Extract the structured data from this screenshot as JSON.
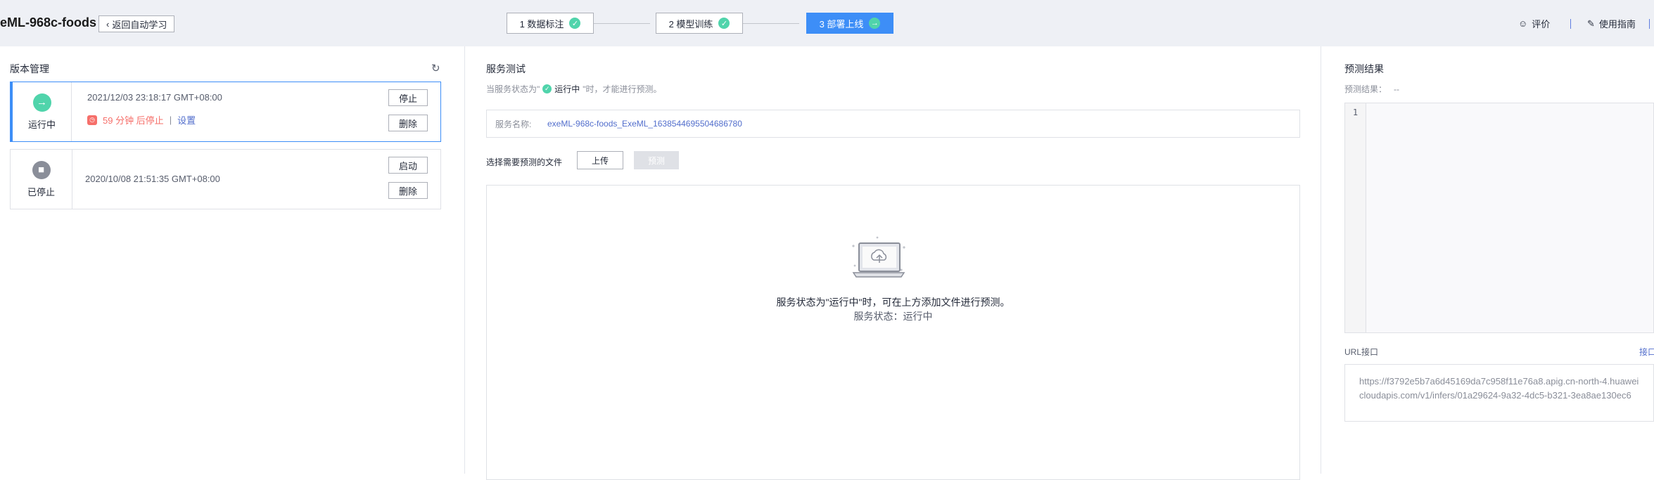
{
  "header": {
    "title": "eML-968c-foods",
    "back_label": "返回自动学习",
    "steps": [
      {
        "label": "1 数据标注",
        "state": "done"
      },
      {
        "label": "2 模型训练",
        "state": "done"
      },
      {
        "label": "3 部署上线",
        "state": "active"
      }
    ],
    "rate_label": "评价",
    "guide_label": "使用指南"
  },
  "versions": {
    "title": "版本管理",
    "items": [
      {
        "status": "运行中",
        "time": "2021/12/03 23:18:17 GMT+08:00",
        "warning": "59 分钟 后停止",
        "settings_link": "设置",
        "btn_primary": "停止",
        "btn_delete": "删除"
      },
      {
        "status": "已停止",
        "time": "2020/10/08 21:51:35 GMT+08:00",
        "btn_primary": "启动",
        "btn_delete": "删除"
      }
    ]
  },
  "service_test": {
    "title": "服务测试",
    "hint_prefix": "当服务状态为\"",
    "hint_status": "运行中",
    "hint_suffix": "\"时，才能进行预测。",
    "service_name_label": "服务名称:",
    "service_name_value": "exeML-968c-foods_ExeML_1638544695504686780",
    "file_label": "选择需要预测的文件",
    "upload_label": "上传",
    "predict_label": "预测",
    "drop_message": "服务状态为\"运行中\"时，可在上方添加文件进行预测。",
    "drop_status": "服务状态：运行中"
  },
  "result": {
    "title": "预测结果",
    "result_label": "预测结果：",
    "result_value": "--",
    "line_number": "1",
    "url_label": "URL接口",
    "url_link": "接口",
    "url_value": "https://f3792e5b7a6d45169da7c958f11e76a8.apig.cn-north-4.huaweicloudapis.com/v1/infers/01a29624-9a32-4dc5-b321-3ea8ae130ec6"
  },
  "colors": {
    "primary": "#3d8ef7",
    "success": "#50d4ab",
    "danger": "#f66f6a",
    "link": "#526ecc"
  }
}
